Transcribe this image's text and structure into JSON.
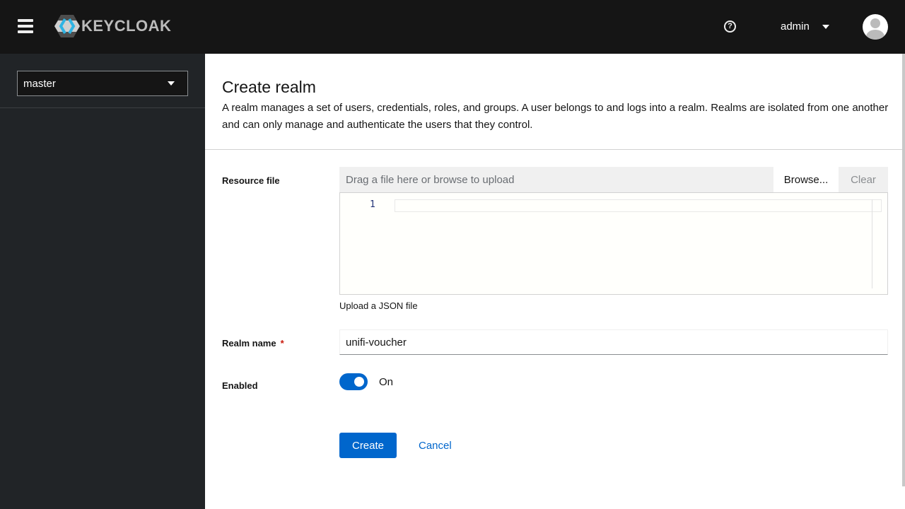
{
  "header": {
    "brand": "KEYCLOAK",
    "help_icon": "?",
    "user": "admin"
  },
  "sidebar": {
    "realm": "master"
  },
  "page": {
    "title": "Create realm",
    "description": "A realm manages a set of users, credentials, roles, and groups. A user belongs to and logs into a realm. Realms are isolated from one another and can only manage and authenticate the users that they control."
  },
  "form": {
    "resource_file_label": "Resource file",
    "upload_placeholder": "Drag a file here or browse to upload",
    "browse_label": "Browse...",
    "clear_label": "Clear",
    "line_number": "1",
    "upload_helper": "Upload a JSON file",
    "realm_name_label": "Realm name",
    "required_mark": "*",
    "realm_name_value": "unifi-voucher",
    "enabled_label": "Enabled",
    "enabled_state": "On",
    "create_label": "Create",
    "cancel_label": "Cancel"
  }
}
